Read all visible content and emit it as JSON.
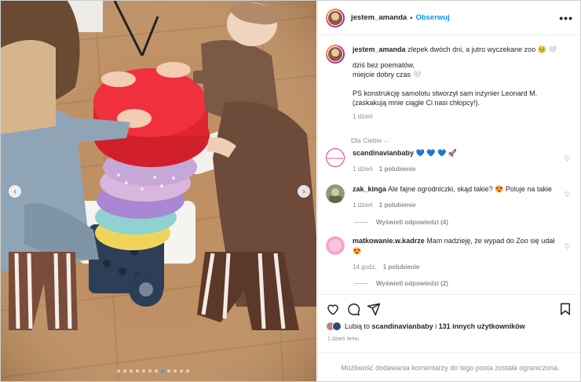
{
  "post": {
    "username": "jestem_amanda",
    "separator": "•",
    "follow_label": "Obserwuj",
    "more_label": "•••"
  },
  "caption": {
    "username": "jestem_amanda",
    "line1": "zlepek dwóch dni, a jutro wyczekane zoo 🥹 🤍",
    "line2": "dziś bez poematów,",
    "line3": "miejcie dobry czas 🤍",
    "line4": "PS konstrukcję samolotu stworzył sam inżynier Leonard M.",
    "line5": "(zaskakują mnie ciągle Ci nasi chłopcy!).",
    "time": "1 dzień"
  },
  "for_you_label": "Dla Ciebie ⌵",
  "comments": [
    {
      "username": "scandinavianbaby",
      "text": "💙 💙 💙 🚀",
      "time": "1 dzień",
      "likes": "1 polubienie"
    },
    {
      "username": "zak_kinga",
      "text": "Ale fajne ogrodniczki, skąd takie? 😍 Poluje na takie",
      "time": "1 dzień",
      "likes": "1 polubienie",
      "replies": "Wyświetl odpowiedzi (4)"
    },
    {
      "username": "matkowanie.w.kadrze",
      "text": "Mam nadzieję, że wypad do Zoo się udał 😍",
      "time": "14 godz.",
      "likes": "1 polubienie",
      "replies": "Wyświetl odpowiedzi (2)"
    }
  ],
  "likes_line": {
    "prefix": "Lubią to",
    "user": "scandinavianbaby",
    "middle": "i",
    "others": "131 innych użytkowników"
  },
  "date": "1 dzień temu",
  "footer": "Możliwość dodawania komentarzy do tego posta została ograniczona.",
  "carousel": {
    "total": 12,
    "active_index": 7
  }
}
